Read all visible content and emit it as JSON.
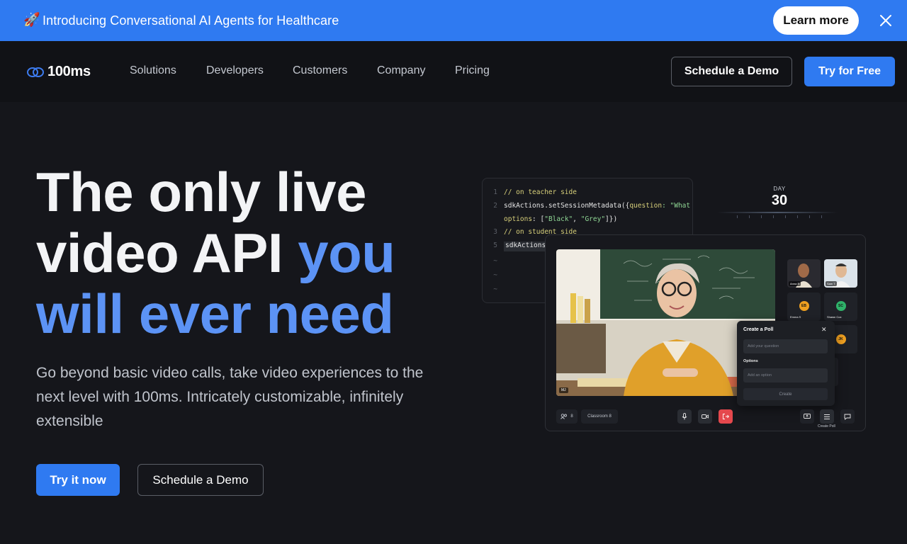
{
  "banner": {
    "icon": "rocket-icon",
    "emoji": "🚀",
    "text": "Introducing Conversational AI Agents for Healthcare",
    "cta": "Learn more",
    "background": "#2f7af1"
  },
  "nav": {
    "brand": "100ms",
    "items": [
      "Solutions",
      "Developers",
      "Customers",
      "Company",
      "Pricing"
    ],
    "schedule_demo": "Schedule a Demo",
    "try_free": "Try for Free"
  },
  "hero": {
    "title_line1": "The only live",
    "title_line2_plain": "video API ",
    "title_line2_accent": "you",
    "title_line3_accent": "will ever need",
    "subtitle": "Go beyond basic video calls, take video experiences to the next level with 100ms. Intricately customizable, infinitely extensible",
    "cta_primary": "Try it now",
    "cta_secondary": "Schedule a Demo",
    "accent_color": "#5c93f5"
  },
  "code": {
    "lines": [
      {
        "num": "1",
        "parts": [
          {
            "t": "// on teacher side",
            "c": "comment"
          }
        ]
      },
      {
        "num": "2",
        "parts": [
          {
            "t": "sdkActions.setSessionMetadata({",
            "c": "plain"
          },
          {
            "t": "question",
            "c": "key"
          },
          {
            "t": ": \"What is",
            "c": "str"
          }
        ]
      },
      {
        "num": "",
        "parts": [
          {
            "t": "options",
            "c": "key"
          },
          {
            "t": ": [",
            "c": "plain"
          },
          {
            "t": "\"Black\"",
            "c": "str"
          },
          {
            "t": ", ",
            "c": "plain"
          },
          {
            "t": "\"Grey\"",
            "c": "str"
          },
          {
            "t": "]})",
            "c": "plain"
          }
        ]
      },
      {
        "num": "3",
        "parts": [
          {
            "t": "// on student side",
            "c": "comment"
          }
        ]
      },
      {
        "num": "5",
        "parts": [
          {
            "t": "sdkActions.",
            "c": "plain"
          }
        ]
      }
    ]
  },
  "day": {
    "label": "DAY",
    "value": "30"
  },
  "video": {
    "main_label": "MJ",
    "tiles": [
      {
        "name": "Anna R"
      },
      {
        "name": "Sam T"
      },
      {
        "name": "Emma S",
        "initials": "EB",
        "color": "#f0a020"
      },
      {
        "name": "Shawn Cox",
        "initials": "SC",
        "color": "#2fb36a"
      },
      {
        "name": "",
        "initials": "JK",
        "color": "#f0a020"
      }
    ],
    "participants_count": "8",
    "room_name": "Classroom 8",
    "create_poll_label": "Create Poll"
  },
  "poll": {
    "title": "Create a Poll",
    "question_placeholder": "Add your question",
    "options_label": "Options",
    "option_placeholder": "Add an option",
    "create": "Create"
  }
}
